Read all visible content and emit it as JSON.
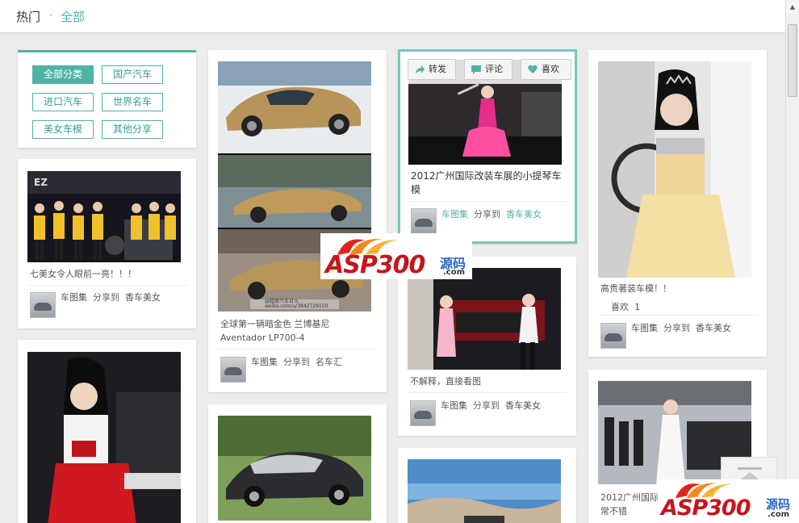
{
  "header": {
    "hot": "热门",
    "dot": "·",
    "all": "全部"
  },
  "categories": [
    "全部分类",
    "国产汽车",
    "进口汽车",
    "世界名车",
    "美女车模",
    "其他分享"
  ],
  "share_verb": "分享到",
  "posts": [
    {
      "caption": "七美女令人眼前一亮！！！",
      "user": "车图集",
      "board": "香车美女"
    },
    {
      "caption": "全球第一辆暗金色 兰博基尼 Aventador LP700-4",
      "user": "车图集",
      "board": "名车汇",
      "watermark": "@超级汽车日火\nweibo.com/u/3842729150"
    },
    {
      "caption": "2012广州国际改装车展的小提琴车模",
      "user": "车图集",
      "board": "香车美女"
    },
    {
      "caption": "不解释，直接看图",
      "user": "车图集",
      "board": "香车美女"
    },
    {
      "caption": "高贵著装车模！！",
      "likes_label": "喜欢",
      "likes": "1",
      "user": "车图集",
      "board": "香车美女"
    },
    {
      "caption": "2012广州国际",
      "caption2": "常不错"
    }
  ],
  "hover_actions": {
    "forward": "转发",
    "comment": "评论",
    "like": "喜欢"
  },
  "watermark": {
    "brand": "ASP300",
    "cn": "源码",
    "domain": ".com"
  },
  "colors": {
    "accent": "#4fb3a4",
    "brand_red": "#c4161c",
    "brand_blue": "#2b67c9"
  }
}
